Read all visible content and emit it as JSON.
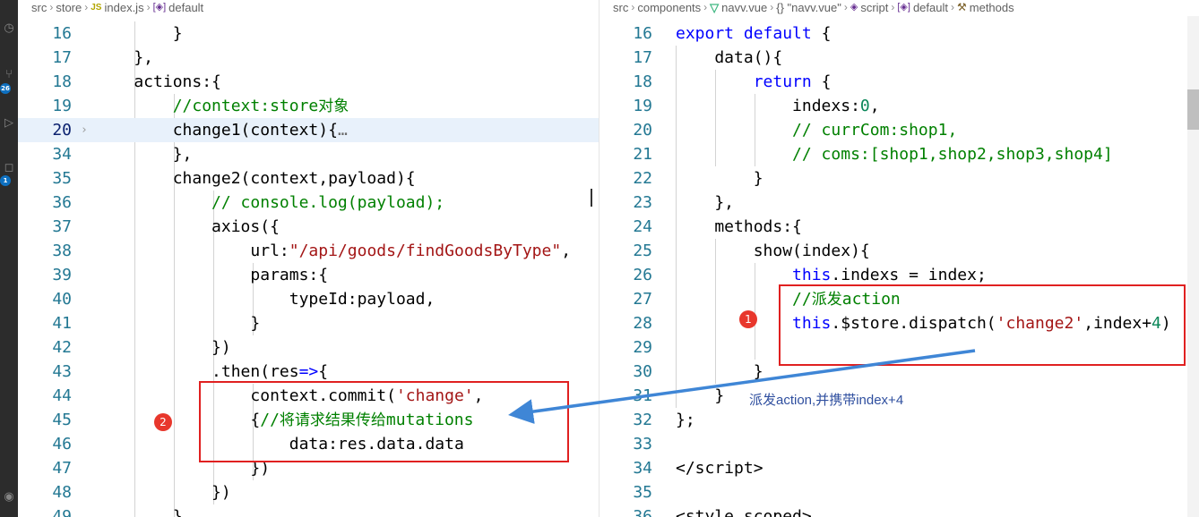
{
  "activity_bar": {
    "badges": [
      "26",
      "1"
    ]
  },
  "left_editor": {
    "breadcrumb": [
      "src",
      "store",
      "index.js",
      "default"
    ],
    "lines": [
      {
        "no": "16",
        "html": "        }"
      },
      {
        "no": "17",
        "html": "    },"
      },
      {
        "no": "18",
        "html": "    actions:{"
      },
      {
        "no": "19",
        "html": "        <span class=\"cm\">//context:store<span class=\"cjk\">对象</span></span>"
      },
      {
        "no": "20",
        "html": "        change1(context){<span class=\"ellipsis\">…</span>",
        "current": true,
        "fold": "›"
      },
      {
        "no": "34",
        "html": "        },"
      },
      {
        "no": "35",
        "html": "        change2(context,payload){"
      },
      {
        "no": "36",
        "html": "            <span class=\"cm\">// console.log(payload);</span>"
      },
      {
        "no": "37",
        "html": "            axios({"
      },
      {
        "no": "38",
        "html": "                url:<span class=\"str\">\"/api/goods/findGoodsByType\"</span>,"
      },
      {
        "no": "39",
        "html": "                params:{"
      },
      {
        "no": "40",
        "html": "                    typeId:payload,"
      },
      {
        "no": "41",
        "html": "                }"
      },
      {
        "no": "42",
        "html": "            })"
      },
      {
        "no": "43",
        "html": "            .then(res<span class=\"kw\">=&gt;</span>{"
      },
      {
        "no": "44",
        "html": "                context.commit(<span class=\"str\">'change'</span>,"
      },
      {
        "no": "45",
        "html": "                {<span class=\"cm\">//<span class=\"cjk\">将请求结果传给</span>mutations</span>"
      },
      {
        "no": "46",
        "html": "                    data:res.data.data"
      },
      {
        "no": "47",
        "html": "                })"
      },
      {
        "no": "48",
        "html": "            })"
      },
      {
        "no": "49",
        "html": "        },"
      }
    ]
  },
  "right_editor": {
    "breadcrumb": [
      "src",
      "components",
      "navv.vue",
      "{} \"navv.vue\"",
      "script",
      "default",
      "methods"
    ],
    "lines": [
      {
        "no": "16",
        "html": "<span class=\"kw\">export</span> <span class=\"kw\">default</span> {"
      },
      {
        "no": "17",
        "html": "    data(){"
      },
      {
        "no": "18",
        "html": "        <span class=\"kw\">return</span> {"
      },
      {
        "no": "19",
        "html": "            indexs:<span class=\"num\">0</span>,"
      },
      {
        "no": "20",
        "html": "            <span class=\"cm\">// currCom:shop1,</span>"
      },
      {
        "no": "21",
        "html": "            <span class=\"cm\">// coms:[shop1,shop2,shop3,shop4]</span>"
      },
      {
        "no": "22",
        "html": "        }"
      },
      {
        "no": "23",
        "html": "    },"
      },
      {
        "no": "24",
        "html": "    methods:{"
      },
      {
        "no": "25",
        "html": "        show(index){"
      },
      {
        "no": "26",
        "html": "            <span class=\"kw\">this</span>.indexs = index;"
      },
      {
        "no": "27",
        "html": "            <span class=\"cm\">//<span class=\"cjk\">派发</span>action</span>"
      },
      {
        "no": "28",
        "html": "            <span class=\"kw\">this</span>.$store.dispatch(<span class=\"str\">'change2'</span>,index+<span class=\"num\">4</span>)"
      },
      {
        "no": "29",
        "html": ""
      },
      {
        "no": "30",
        "html": "        }"
      },
      {
        "no": "31",
        "html": "    }"
      },
      {
        "no": "32",
        "html": "};"
      },
      {
        "no": "33",
        "html": ""
      },
      {
        "no": "34",
        "html": "&lt;/script&gt;"
      },
      {
        "no": "35",
        "html": ""
      },
      {
        "no": "36",
        "html": "&lt;style scoped&gt;"
      }
    ]
  },
  "annotations": {
    "marker1": "1",
    "marker2": "2",
    "note": "派发action,并携带index+4"
  },
  "colors": {
    "highlight_box": "#e02020",
    "arrow": "#3f86d6",
    "marker": "#e8372c"
  }
}
